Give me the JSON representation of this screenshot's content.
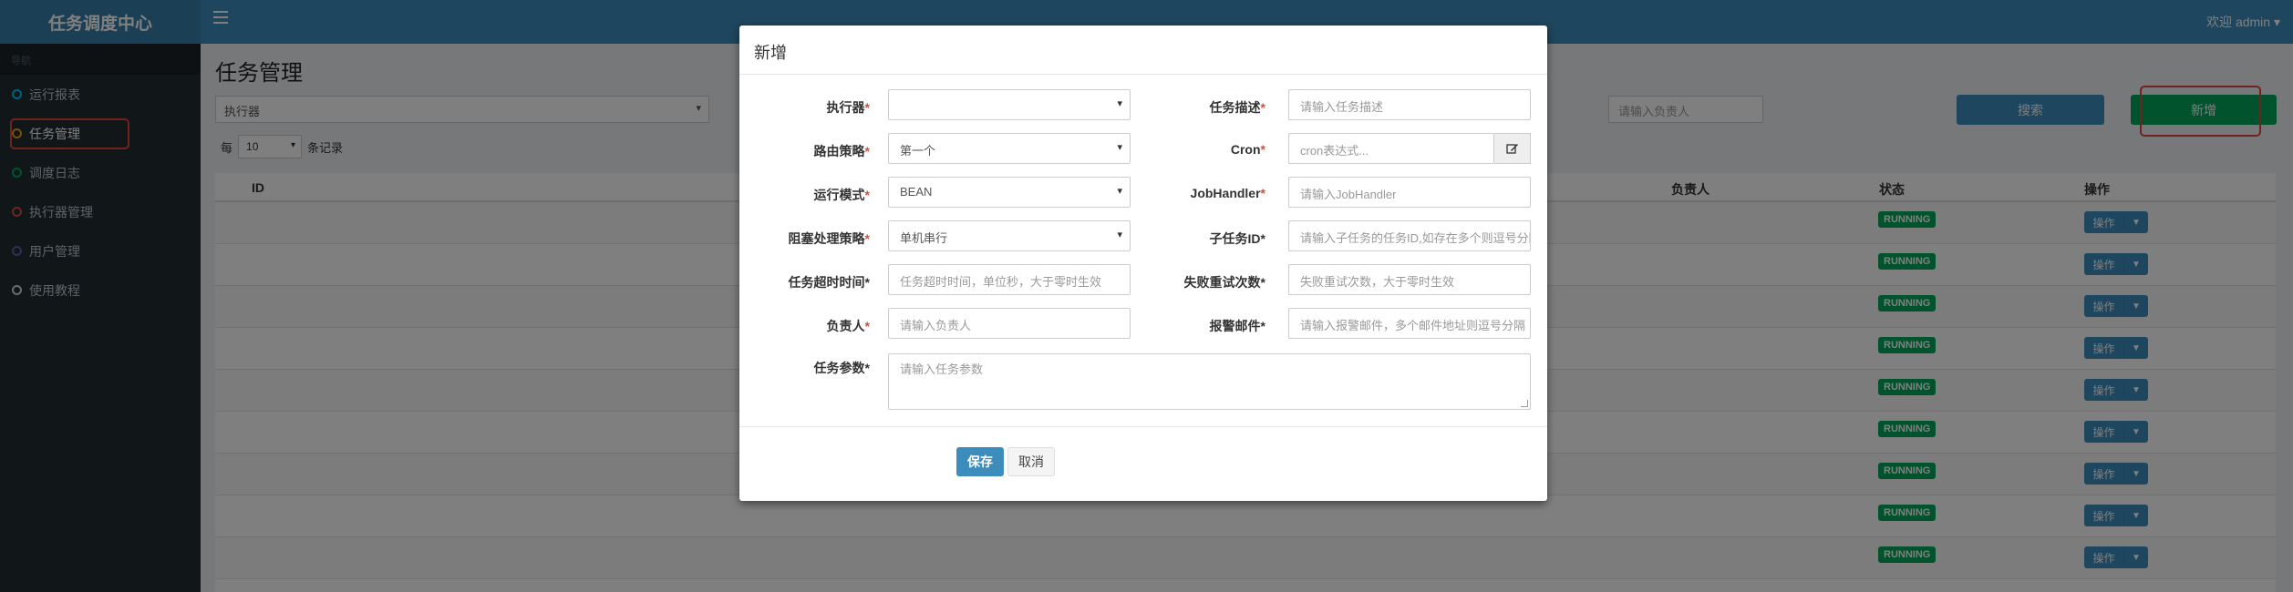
{
  "app": {
    "title": "任务调度中心",
    "welcome": "欢迎 admin ▾"
  },
  "sidebar": {
    "header": "导航",
    "items": [
      {
        "label": "运行报表",
        "color": "#00c0ef"
      },
      {
        "label": "任务管理",
        "color": "#f39c12"
      },
      {
        "label": "调度日志",
        "color": "#00a65a"
      },
      {
        "label": "执行器管理",
        "color": "#dd4b39"
      },
      {
        "label": "用户管理",
        "color": "#605ca8"
      },
      {
        "label": "使用教程",
        "color": "#d2d6de"
      }
    ]
  },
  "main": {
    "title": "任务管理",
    "filter_value": "执行器",
    "owner_placeholder": "请输入负责人",
    "search_label": "搜索",
    "add_label": "新增",
    "page_size_prefix": "每",
    "page_size_value": "10",
    "page_size_suffix": "条记录",
    "columns": {
      "id": "ID",
      "owner": "负责人",
      "status": "状态",
      "ops": "操作"
    },
    "rows": [
      {
        "status": "RUNNING",
        "op": "操作"
      },
      {
        "status": "RUNNING",
        "op": "操作"
      },
      {
        "status": "RUNNING",
        "op": "操作"
      },
      {
        "status": "RUNNING",
        "op": "操作"
      },
      {
        "status": "RUNNING",
        "op": "操作"
      },
      {
        "status": "RUNNING",
        "op": "操作"
      },
      {
        "status": "RUNNING",
        "op": "操作"
      },
      {
        "status": "RUNNING",
        "op": "操作"
      },
      {
        "status": "RUNNING",
        "op": "操作"
      }
    ]
  },
  "modal": {
    "title": "新增",
    "executor": {
      "label": "执行器",
      "value": ""
    },
    "job_desc": {
      "label": "任务描述",
      "placeholder": "请输入任务描述"
    },
    "route": {
      "label": "路由策略",
      "value": "第一个"
    },
    "cron": {
      "label": "Cron",
      "placeholder": "cron表达式..."
    },
    "run_mode": {
      "label": "运行模式",
      "value": "BEAN"
    },
    "job_handler": {
      "label": "JobHandler",
      "placeholder": "请输入JobHandler"
    },
    "block": {
      "label": "阻塞处理策略",
      "value": "单机串行"
    },
    "child_id": {
      "label": "子任务ID",
      "placeholder": "请输入子任务的任务ID,如存在多个则逗号分隔"
    },
    "timeout": {
      "label": "任务超时时间",
      "placeholder": "任务超时时间，单位秒，大于零时生效"
    },
    "retry": {
      "label": "失败重试次数",
      "placeholder": "失败重试次数，大于零时生效"
    },
    "owner": {
      "label": "负责人",
      "placeholder": "请输入负责人"
    },
    "alarm": {
      "label": "报警邮件",
      "placeholder": "请输入报警邮件，多个邮件地址则逗号分隔"
    },
    "params": {
      "label": "任务参数",
      "placeholder": "请输入任务参数"
    },
    "save_label": "保存",
    "cancel_label": "取消"
  }
}
